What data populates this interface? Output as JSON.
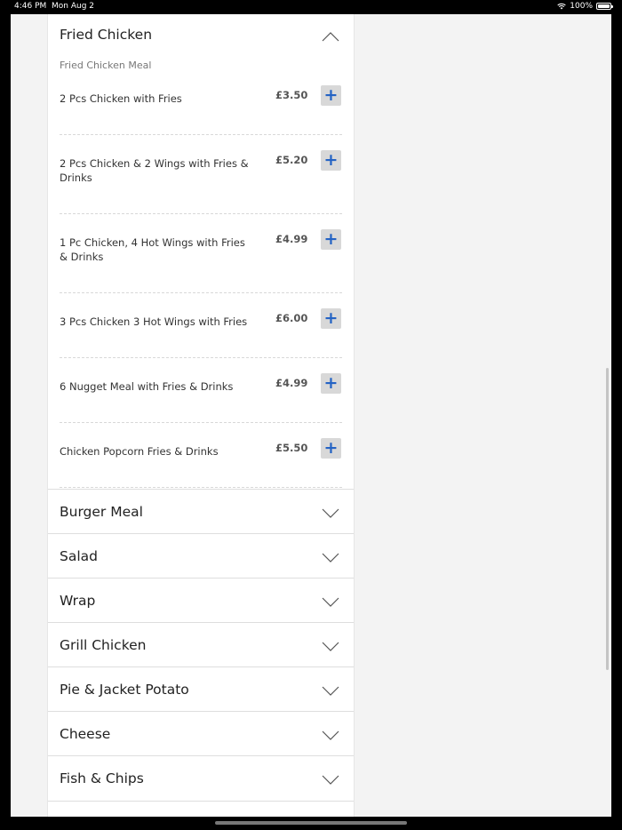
{
  "status_bar": {
    "time": "4:46 PM",
    "date": "Mon Aug 2",
    "battery": "100%"
  },
  "expanded_section": {
    "title": "Fried Chicken",
    "subheading": "Fried Chicken Meal",
    "items": [
      {
        "name": "2 Pcs Chicken with Fries",
        "price": "£3.50"
      },
      {
        "name": "2 Pcs Chicken & 2 Wings with Fries & Drinks",
        "price": "£5.20"
      },
      {
        "name": "1 Pc Chicken, 4 Hot Wings with Fries & Drinks",
        "price": "£4.99"
      },
      {
        "name": "3 Pcs Chicken 3 Hot Wings with Fries",
        "price": "£6.00"
      },
      {
        "name": "6 Nugget Meal with Fries & Drinks",
        "price": "£4.99"
      },
      {
        "name": "Chicken Popcorn Fries & Drinks",
        "price": "£5.50"
      }
    ],
    "add_symbol": "+"
  },
  "categories": [
    {
      "title": "Burger Meal"
    },
    {
      "title": "Salad"
    },
    {
      "title": "Wrap"
    },
    {
      "title": "Grill Chicken"
    },
    {
      "title": "Pie & Jacket Potato"
    },
    {
      "title": "Cheese"
    },
    {
      "title": "Fish & Chips"
    }
  ],
  "colors": {
    "accent": "#2463c4",
    "button_bg": "#d8d8d8",
    "page_bg": "#f3f3f3"
  }
}
